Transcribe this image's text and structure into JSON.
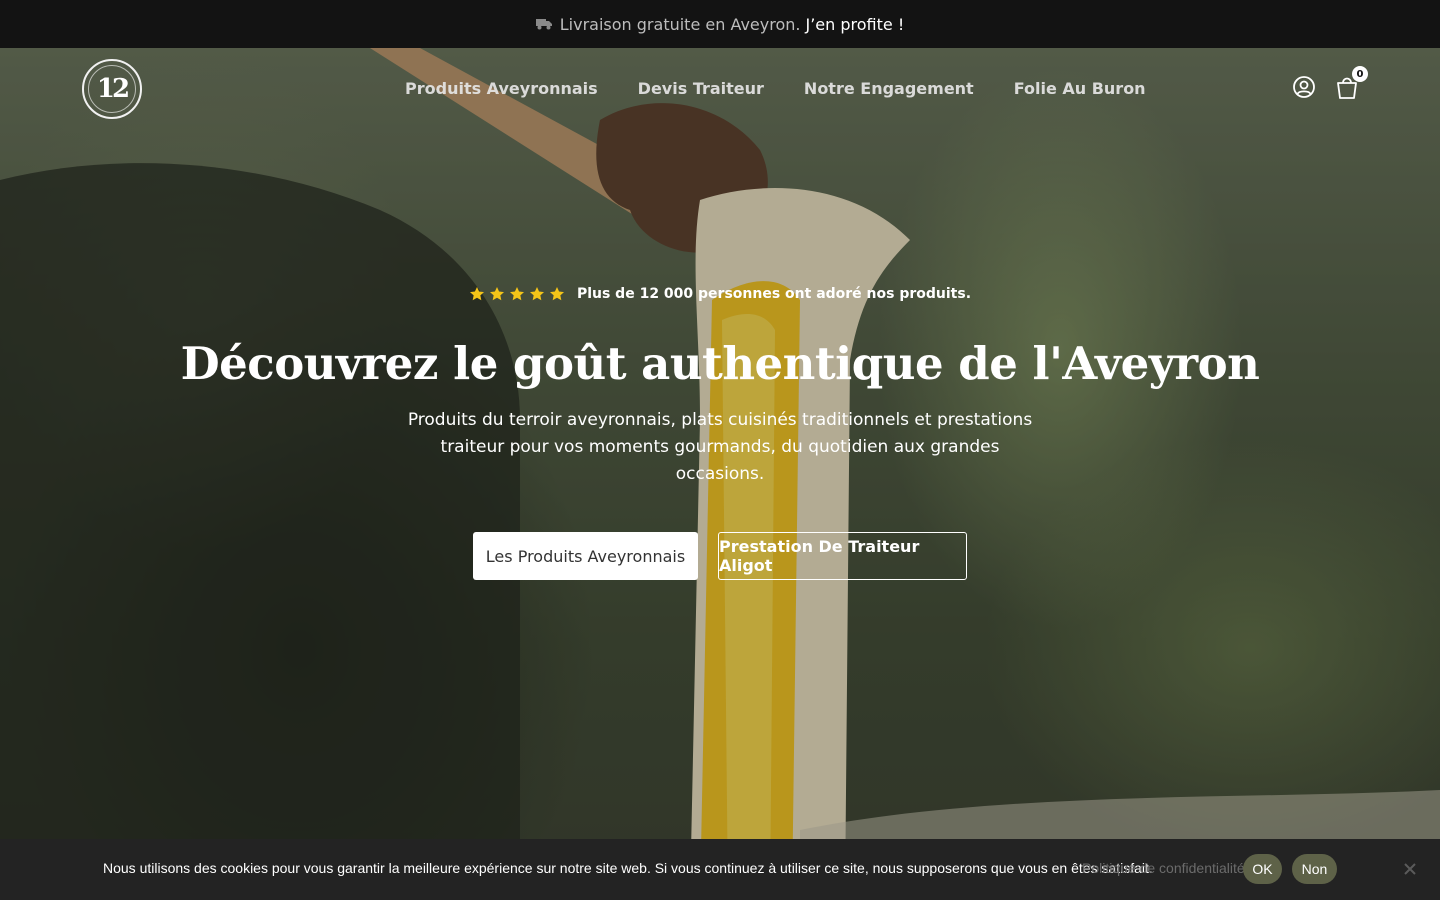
{
  "announcement": {
    "icon": "truck-icon",
    "text": "Livraison gratuite en Aveyron.",
    "link": "J’en profite !"
  },
  "header": {
    "logo_text": "12",
    "nav": [
      {
        "label": "Produits Aveyronnais"
      },
      {
        "label": "Devis Traiteur"
      },
      {
        "label": "Notre Engagement"
      },
      {
        "label": "Folie Au Buron"
      }
    ],
    "cart_count": "0",
    "icons": [
      "user-icon",
      "cart-icon"
    ]
  },
  "hero": {
    "rating_stars": 5,
    "star_color": "#f5c518",
    "rating_text": "Plus de 12 000 personnes ont adoré nos produits.",
    "title": "Découvrez le goût authentique de l'Aveyron",
    "subtitle_lines": [
      "Produits du terroir aveyronnais, plats cuisinés traditionnels et prestations",
      "traiteur pour vos moments gourmands, du quotidien aux grandes",
      "occasions."
    ],
    "primary_button": "Les Produits Aveyronnais",
    "secondary_button": "Prestation De Traiteur Aligot"
  },
  "cookie": {
    "text": "Nous utilisons des cookies pour vous garantir la meilleure expérience sur notre site web. Si vous continuez à utiliser ce site, nous supposerons que vous en êtes satisfait.",
    "policy_link": "Politique de confidentialité",
    "ok_label": "OK",
    "no_label": "Non",
    "button_color": "#5e6248"
  }
}
